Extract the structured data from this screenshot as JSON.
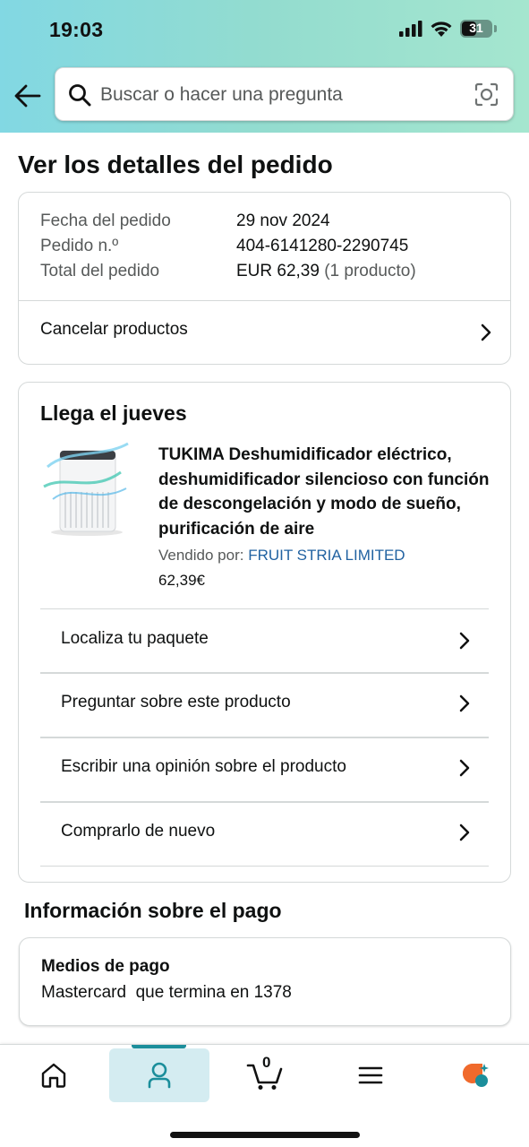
{
  "status_bar": {
    "time": "19:03",
    "battery": "31"
  },
  "search": {
    "placeholder": "Buscar o hacer una pregunta"
  },
  "page_title": "Ver los detalles del pedido",
  "order_summary": {
    "date_label": "Fecha del pedido",
    "date_value": "29 nov 2024",
    "order_no_label": "Pedido n.º",
    "order_no_value": "404-6141280-2290745",
    "total_label": "Total del pedido",
    "total_value": "EUR 62,39",
    "total_count": "(1 producto)",
    "cancel_label": "Cancelar productos"
  },
  "shipment": {
    "arrival": "Llega el jueves",
    "product_title": "TUKIMA Deshumidificador eléctrico, deshumidificador silencioso con función de descongelación y modo de sueño, purificación de aire",
    "seller_prefix": "Vendido por:",
    "seller_name": "FRUIT STRIA LIMITED",
    "price": "62,39€",
    "actions": [
      {
        "label": "Localiza tu paquete"
      },
      {
        "label": "Preguntar sobre este producto"
      },
      {
        "label": "Escribir una opinión sobre el producto"
      },
      {
        "label": "Comprarlo de nuevo"
      }
    ]
  },
  "payment": {
    "section_title": "Información sobre el pago",
    "method_label": "Medios de pago",
    "method_value": "Mastercard  que termina en 1378"
  },
  "tabbar": {
    "cart_count": "0",
    "tabs": [
      {
        "icon": "home-icon"
      },
      {
        "icon": "account-icon"
      },
      {
        "icon": "cart-icon"
      },
      {
        "icon": "menu-icon"
      },
      {
        "icon": "rufus-ai-icon"
      }
    ]
  },
  "colors": {
    "accent": "#1b8e9b",
    "link": "#2162a1",
    "header_gradient_start": "#82d8e3",
    "header_gradient_end": "#a5e6cf"
  }
}
